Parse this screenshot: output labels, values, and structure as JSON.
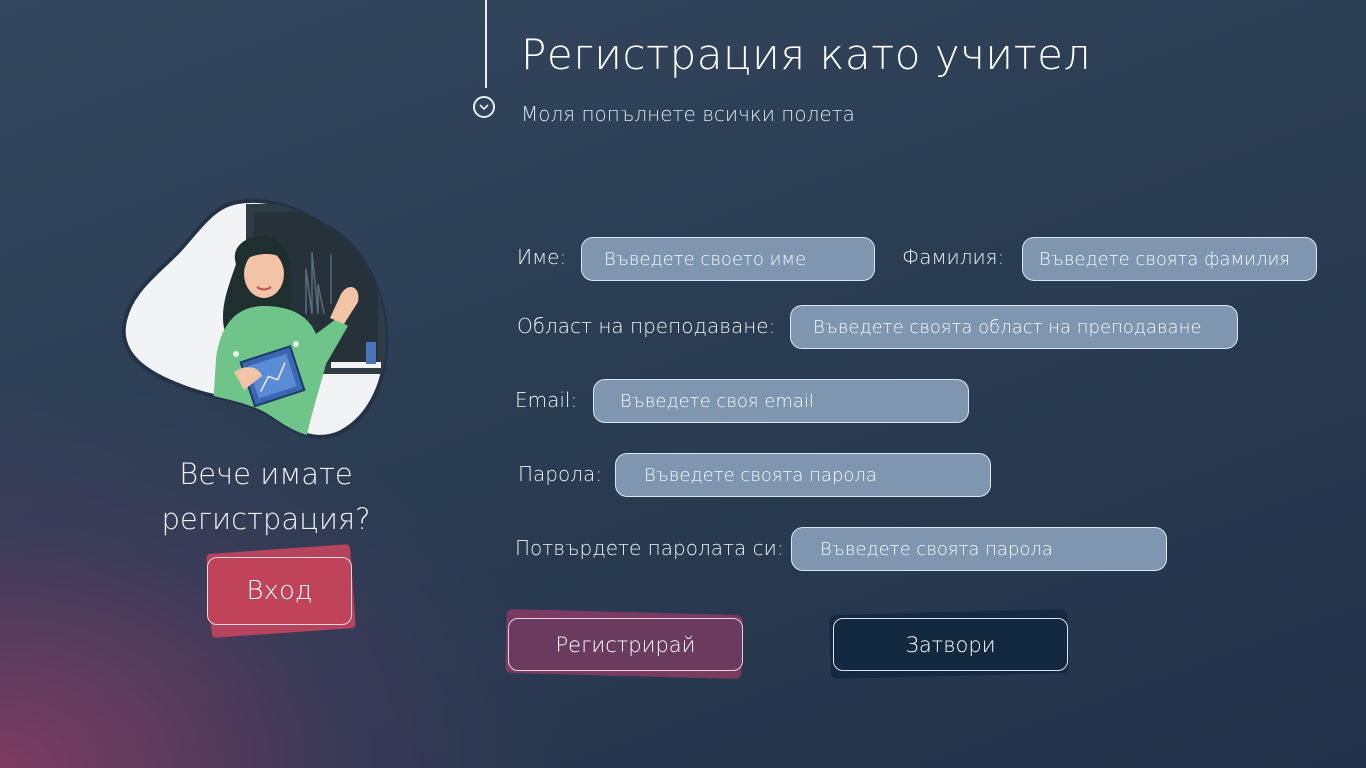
{
  "header": {
    "title": "Регистрация като учител",
    "subtitle": "Моля попълнете всички полета"
  },
  "side": {
    "already_text": "Вече имате регистрация?",
    "login_label": "Вход"
  },
  "form": {
    "first_name": {
      "label": "Име:",
      "placeholder": "Въведете своето име",
      "value": ""
    },
    "last_name": {
      "label": "Фамилия:",
      "placeholder": "Въведете своята фамилия",
      "value": ""
    },
    "subject": {
      "label": "Област на преподаване:",
      "placeholder": "Въведете своята област на преподаване",
      "value": ""
    },
    "email": {
      "label": "Email:",
      "placeholder": "Въведете своя email",
      "value": ""
    },
    "password": {
      "label": "Парола:",
      "placeholder": "Въведете своята парола",
      "value": ""
    },
    "confirm": {
      "label": "Потвърдете паролата си:",
      "placeholder": "Въведете своята парола",
      "value": ""
    }
  },
  "actions": {
    "register_label": "Регистрирай",
    "close_label": "Затвори"
  },
  "colors": {
    "accent_red": "#c0435a",
    "register_purple": "#6b3b5f",
    "close_navy": "#12283f",
    "field_fill": "#7e96b0"
  },
  "icons": {
    "header_marker": "chevron-down-circle-icon",
    "illustration": "teacher-with-book-illustration"
  }
}
